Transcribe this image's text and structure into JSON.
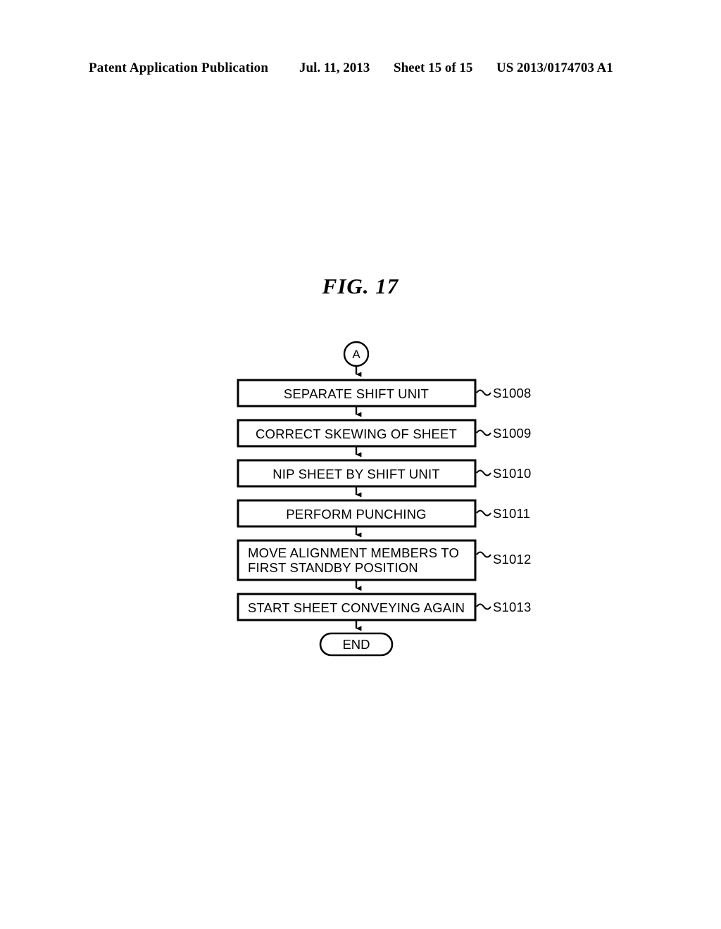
{
  "header": {
    "publication": "Patent Application Publication",
    "date": "Jul. 11, 2013",
    "sheet": "Sheet 15 of 15",
    "document_number": "US 2013/0174703 A1"
  },
  "figure": {
    "title": "FIG. 17",
    "connector_in": "A",
    "terminator_end": "END",
    "steps": [
      {
        "text_line1": "SEPARATE SHIFT UNIT",
        "text_line2": "",
        "label": "S1008",
        "align": "center"
      },
      {
        "text_line1": "CORRECT SKEWING OF SHEET",
        "text_line2": "",
        "label": "S1009",
        "align": "center"
      },
      {
        "text_line1": "NIP SHEET BY SHIFT UNIT",
        "text_line2": "",
        "label": "S1010",
        "align": "center"
      },
      {
        "text_line1": "PERFORM PUNCHING",
        "text_line2": "",
        "label": "S1011",
        "align": "center"
      },
      {
        "text_line1": "MOVE ALIGNMENT MEMBERS TO",
        "text_line2": "FIRST STANDBY POSITION",
        "label": "S1012",
        "align": "left"
      },
      {
        "text_line1": "START SHEET CONVEYING AGAIN",
        "text_line2": "",
        "label": "S1013",
        "align": "center"
      }
    ]
  },
  "colors": {
    "ink": "#000000",
    "paper": "#ffffff"
  }
}
